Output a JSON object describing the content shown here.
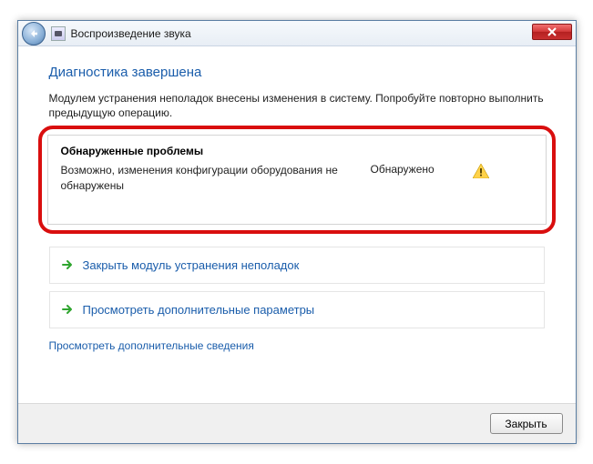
{
  "window": {
    "title": "Воспроизведение звука"
  },
  "heading": "Диагностика завершена",
  "intro": "Модулем устранения неполадок внесены изменения в систему. Попробуйте повторно выполнить предыдущую операцию.",
  "problems": {
    "title": "Обнаруженные проблемы",
    "items": [
      {
        "desc": "Возможно, изменения конфигурации оборудования не обнаружены",
        "status": "Обнаружено"
      }
    ]
  },
  "actions": {
    "close_tr": "Закрыть модуль устранения неполадок",
    "advanced": "Просмотреть дополнительные параметры"
  },
  "more_info": "Просмотреть дополнительные сведения",
  "buttons": {
    "close": "Закрыть"
  }
}
